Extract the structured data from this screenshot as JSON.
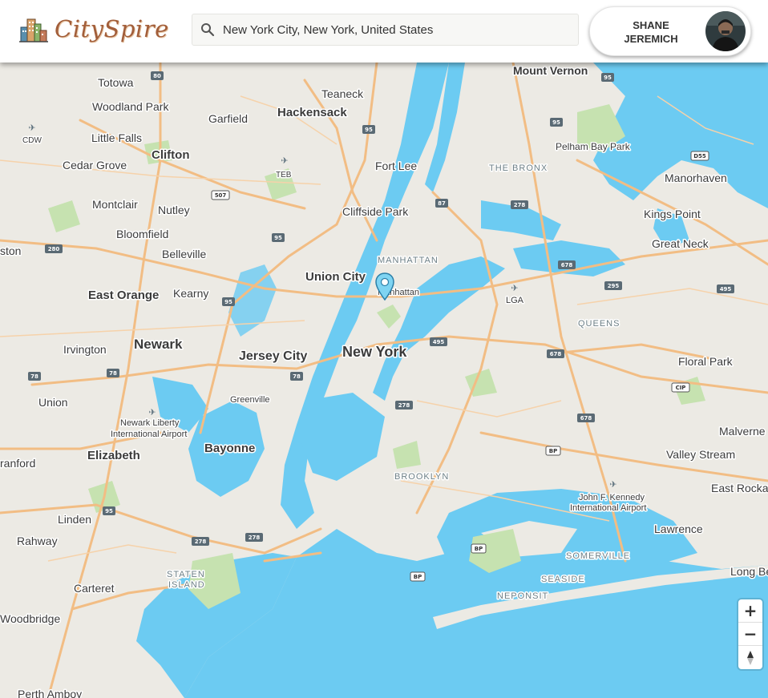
{
  "app": {
    "name": "CitySpire"
  },
  "search": {
    "value": "New York City, New York, United States"
  },
  "user": {
    "first": "SHANE",
    "last": "JEREMICH"
  },
  "map_controls": {
    "zoom_in": "+",
    "zoom_out": "−"
  },
  "icons": {
    "logo": "city-buildings-icon",
    "search": "search-icon",
    "marker": "map-pin-icon",
    "compass": "compass-icon"
  },
  "colors": {
    "water": "#6ccbf2",
    "land": "#eceae4",
    "park": "#c6e2b0",
    "highway": "#f2bd84",
    "logo_text": "#a25e3a"
  },
  "map": {
    "place_labels": [
      "Totowa",
      "Woodland Park",
      "Teaneck",
      "Mount Vernon",
      "Hackensack",
      "Garfield",
      "Little Falls",
      "Clifton",
      "Cedar Grove",
      "Fort Lee",
      "THE BRONX",
      "Pelham Bay Park",
      "Manorhaven",
      "Montclair",
      "Nutley",
      "Cliffside Park",
      "Kings Point",
      "Bloomfield",
      "Great Neck",
      "Belleville",
      "ston",
      "MANHATTAN",
      "Union City",
      "Manhattan",
      "East Orange",
      "Kearny",
      "LGA",
      "QUEENS",
      "Newark",
      "Irvington",
      "Jersey City",
      "New York",
      "Floral Park",
      "Union",
      "Greenville",
      "Newark Liberty",
      "International Airport",
      "Malverne",
      "Bayonne",
      "Elizabeth",
      "Valley Stream",
      "BROOKLYN",
      "ranford",
      "East Rockaway",
      "John F. Kennedy",
      "International Airport",
      "Linden",
      "Lawrence",
      "Rahway",
      "SOMERVILLE",
      "Long Beach",
      "STATEN",
      "ISLAND",
      "SEASIDE",
      "Carteret",
      "NEPONSIT",
      "Woodbridge",
      "Perth Amboy",
      "CDW",
      "TEB"
    ],
    "shields": [
      "80",
      "95",
      "95",
      "95",
      "507",
      "87",
      "278",
      "95",
      "280",
      "678",
      "295",
      "495",
      "95",
      "495",
      "678",
      "78",
      "78",
      "278",
      "CIP",
      "678",
      "BP",
      "95",
      "278",
      "278",
      "BP",
      "BP",
      "D55"
    ]
  }
}
